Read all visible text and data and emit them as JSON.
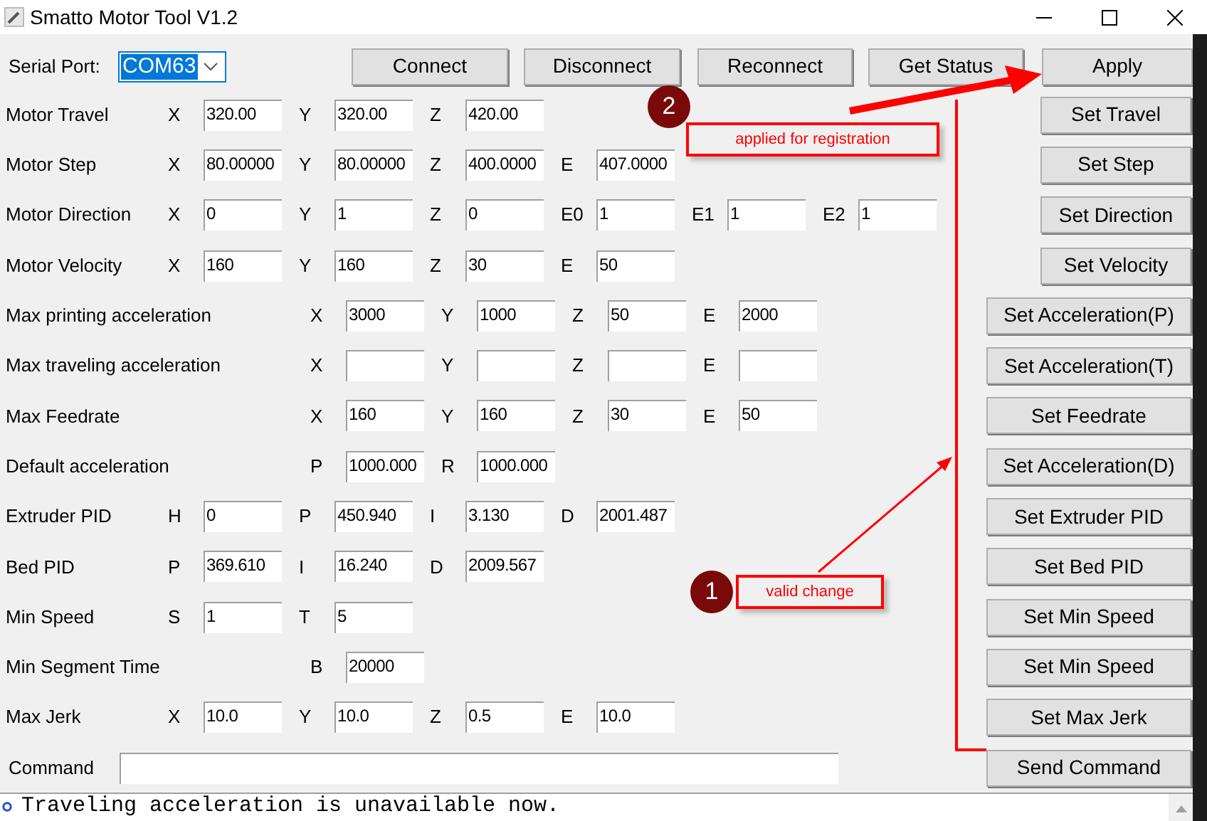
{
  "window": {
    "title": "Smatto Motor Tool V1.2"
  },
  "toolbar": {
    "serial_port_label": "Serial Port:",
    "serial_port": {
      "value": "COM63",
      "focused": true
    },
    "buttons": [
      "Connect",
      "Disconnect",
      "Reconnect",
      "Get Status",
      "Apply"
    ]
  },
  "rows": [
    {
      "label": "Motor Travel",
      "kind": "standard",
      "fields": [
        {
          "axis": "X",
          "value": "320.00"
        },
        {
          "axis": "Y",
          "value": "320.00"
        },
        {
          "axis": "Z",
          "value": "420.00"
        }
      ],
      "button": "Set Travel"
    },
    {
      "label": "Motor Step",
      "kind": "standard",
      "fields": [
        {
          "axis": "X",
          "value": "80.00000"
        },
        {
          "axis": "Y",
          "value": "80.00000"
        },
        {
          "axis": "Z",
          "value": "400.0000"
        },
        {
          "axis": "E",
          "value": "407.0000"
        }
      ],
      "button": "Set Step"
    },
    {
      "label": "Motor Direction",
      "kind": "standard",
      "fields": [
        {
          "axis": "X",
          "value": "0"
        },
        {
          "axis": "Y",
          "value": "1"
        },
        {
          "axis": "Z",
          "value": "0"
        },
        {
          "axis": "E0",
          "value": "1"
        },
        {
          "axis": "E1",
          "value": "1"
        },
        {
          "axis": "E2",
          "value": "1"
        }
      ],
      "button": "Set Direction"
    },
    {
      "label": "Motor Velocity",
      "kind": "standard",
      "fields": [
        {
          "axis": "X",
          "value": "160"
        },
        {
          "axis": "Y",
          "value": "160"
        },
        {
          "axis": "Z",
          "value": "30"
        },
        {
          "axis": "E",
          "value": "50"
        }
      ],
      "button": "Set Velocity"
    },
    {
      "label": "Max printing acceleration",
      "kind": "wide",
      "fields": [
        {
          "axis": "X",
          "value": "3000"
        },
        {
          "axis": "Y",
          "value": "1000"
        },
        {
          "axis": "Z",
          "value": "50"
        },
        {
          "axis": "E",
          "value": "2000"
        }
      ],
      "button": "Set Acceleration(P)"
    },
    {
      "label": "Max traveling acceleration",
      "kind": "wide",
      "fields": [
        {
          "axis": "X"
        },
        {
          "axis": "Y"
        },
        {
          "axis": "Z"
        },
        {
          "axis": "E"
        }
      ],
      "button": "Set Acceleration(T)"
    },
    {
      "label": "Max Feedrate",
      "kind": "wide",
      "fields": [
        {
          "axis": "X",
          "value": "160"
        },
        {
          "axis": "Y",
          "value": "160"
        },
        {
          "axis": "Z",
          "value": "30"
        },
        {
          "axis": "E",
          "value": "50"
        }
      ],
      "button": "Set Feedrate"
    },
    {
      "label": "Default acceleration",
      "kind": "wide",
      "fields": [
        {
          "axis": "P",
          "value": "1000.000"
        },
        {
          "axis": "R",
          "value": "1000.000"
        }
      ],
      "button": "Set Acceleration(D)"
    },
    {
      "label": "Extruder PID",
      "kind": "standard",
      "fields": [
        {
          "axis": "H",
          "value": "0"
        },
        {
          "axis": "P",
          "value": "450.940"
        },
        {
          "axis": "I",
          "value": "3.130"
        },
        {
          "axis": "D",
          "value": "2001.487"
        }
      ],
      "button": "Set Extruder PID"
    },
    {
      "label": "Bed PID",
      "kind": "standard",
      "fields": [
        {
          "axis": "P",
          "value": "369.610"
        },
        {
          "axis": "I",
          "value": "16.240"
        },
        {
          "axis": "D",
          "value": "2009.567"
        }
      ],
      "button": "Set Bed PID"
    },
    {
      "label": "Min Speed",
      "kind": "standard",
      "fields": [
        {
          "axis": "S",
          "value": "1"
        },
        {
          "axis": "T",
          "value": "5"
        }
      ],
      "button": "Set Min Speed"
    },
    {
      "label": "Min Segment Time",
      "kind": "wide",
      "fields": [
        {
          "axis": "B",
          "value": "20000"
        }
      ],
      "button": "Set Min Speed"
    },
    {
      "label": "Max Jerk",
      "kind": "standard",
      "fields": [
        {
          "axis": "X",
          "value": "10.0"
        },
        {
          "axis": "Y",
          "value": "10.0"
        },
        {
          "axis": "Z",
          "value": "0.5"
        },
        {
          "axis": "E",
          "value": "10.0"
        }
      ],
      "button": "Set Max Jerk"
    },
    {
      "label": "Command",
      "kind": "command",
      "button": "Send Command"
    }
  ],
  "log": [
    "Traveling acceleration is unavailable now."
  ],
  "annotations": [
    {
      "number": "2",
      "text": "applied for registration"
    },
    {
      "number": "1",
      "text": "valid change"
    }
  ]
}
